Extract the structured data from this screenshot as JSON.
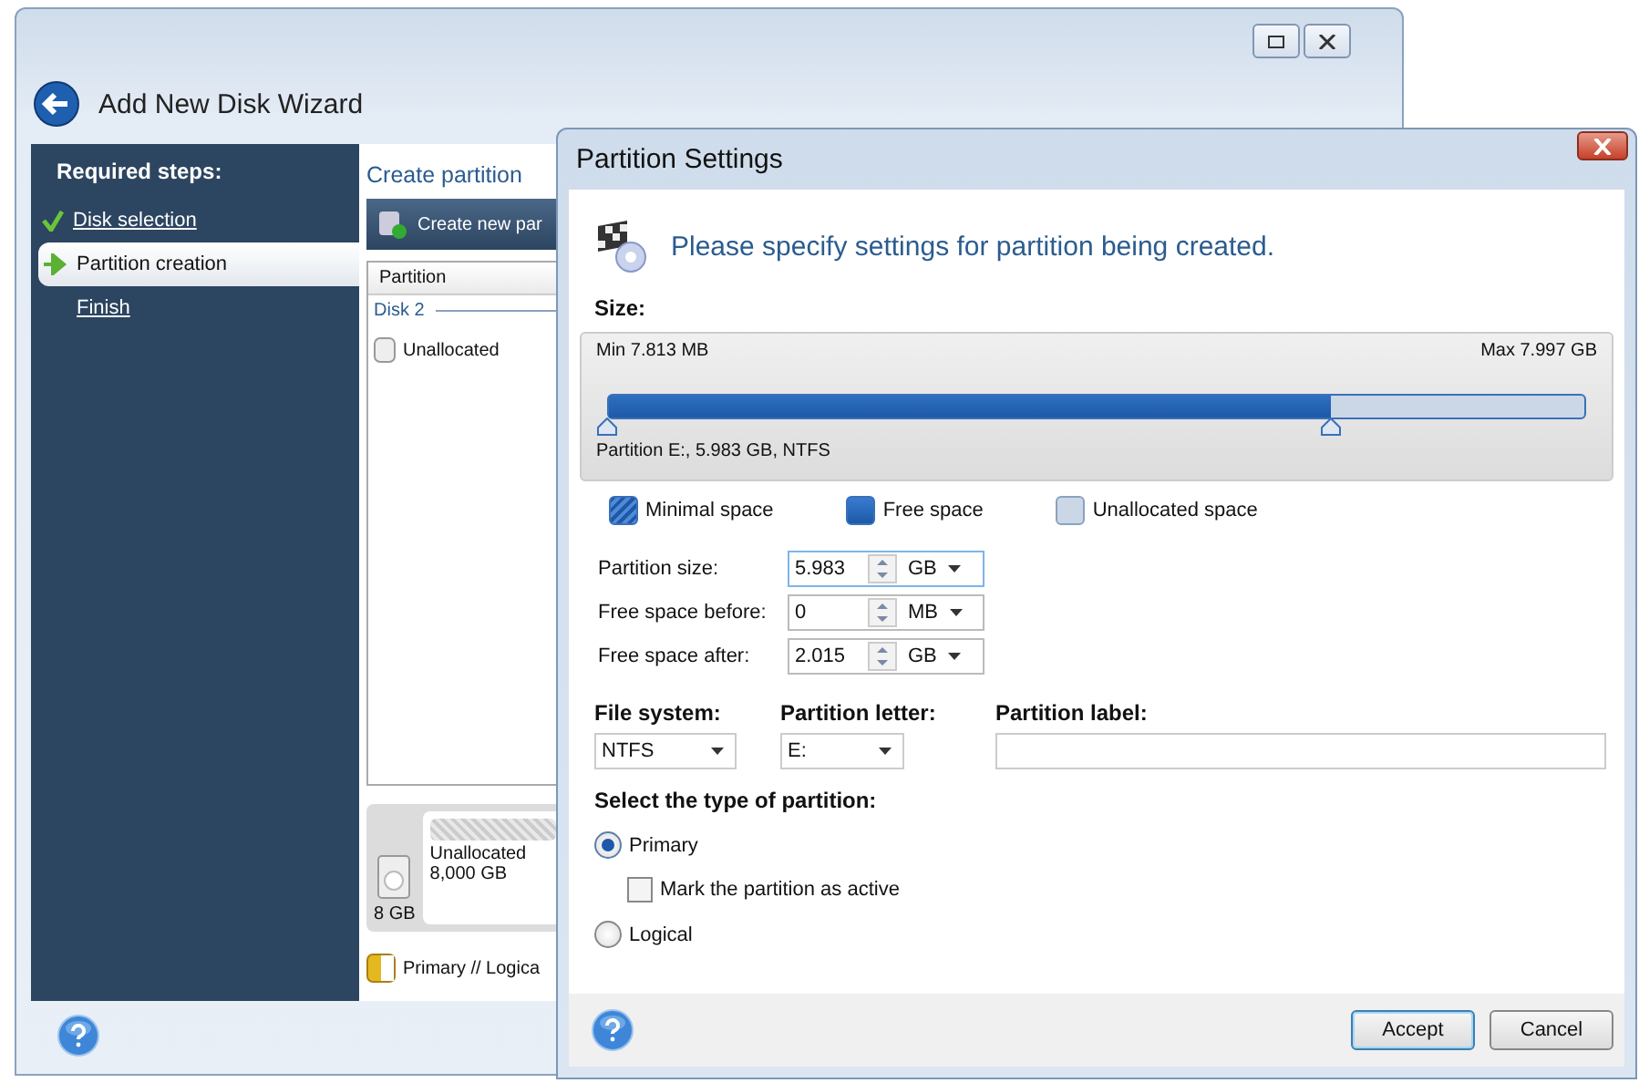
{
  "main_window": {
    "title": "Add New Disk Wizard",
    "sidebar": {
      "heading": "Required steps:",
      "steps": [
        {
          "label": "Disk selection",
          "kind": "done",
          "selected": false
        },
        {
          "label": "Partition creation",
          "kind": "current",
          "selected": true
        },
        {
          "label": "Finish",
          "kind": "pending",
          "selected": false
        }
      ]
    },
    "content": {
      "heading": "Create partition",
      "toolbar_button": "Create new par",
      "table": {
        "column": "Partition",
        "group": "Disk 2",
        "rows": [
          {
            "label": "Unallocated",
            "selected": false
          }
        ]
      },
      "disk_map": {
        "size": "8 GB",
        "name": "Unallocated",
        "capacity": "8,000 GB"
      },
      "legend": "Primary // Logica"
    }
  },
  "dialog": {
    "title": "Partition Settings",
    "intro": "Please specify settings for partition being created.",
    "size_label": "Size:",
    "slider": {
      "min": "Min 7.813 MB",
      "max": "Max 7.997 GB",
      "level": 0.74,
      "caption": "Partition E:, 5.983 GB, NTFS"
    },
    "legend": [
      {
        "label": "Minimal space",
        "kind": "minimal"
      },
      {
        "label": "Free space",
        "kind": "free"
      },
      {
        "label": "Unallocated space",
        "kind": "unallocated"
      }
    ],
    "fields": [
      {
        "label": "Partition size:",
        "value": "5.983",
        "unit": "GB",
        "focused": true
      },
      {
        "label": "Free space before:",
        "value": "0",
        "unit": "MB",
        "focused": false
      },
      {
        "label": "Free space after:",
        "value": "2.015",
        "unit": "GB",
        "focused": false
      }
    ],
    "file_system": {
      "label": "File system:",
      "value": "NTFS"
    },
    "partition_letter": {
      "label": "Partition letter:",
      "value": "E:"
    },
    "partition_label": {
      "label": "Partition label:"
    },
    "type_heading": "Select the type of partition:",
    "types": [
      {
        "kind": "radio",
        "label": "Primary",
        "selected": true
      },
      {
        "kind": "checkbox",
        "label": "Mark the partition as active",
        "checked": false
      },
      {
        "kind": "radio",
        "label": "Logical",
        "selected": false
      }
    ],
    "buttons": [
      {
        "label": "Accept",
        "default": true
      },
      {
        "label": "Cancel",
        "default": false
      }
    ]
  }
}
